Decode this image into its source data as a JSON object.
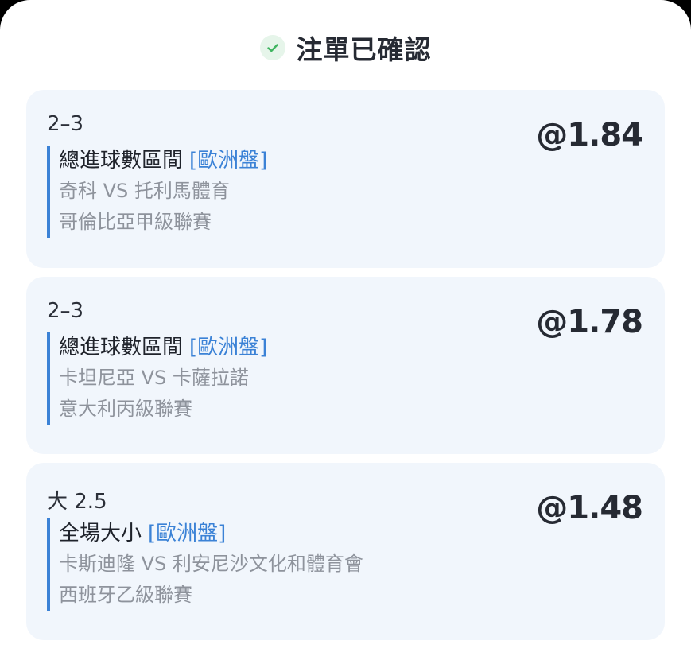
{
  "header": {
    "title": "注單已確認",
    "icon": "check-circle-icon",
    "icon_color": "#3fb560"
  },
  "colors": {
    "card_background": "#f1f6fc",
    "accent": "#3b82d6",
    "muted_text": "#8e939c"
  },
  "bets": [
    {
      "selection": "2–3",
      "odds": "@1.84",
      "market": "總進球數區間",
      "market_tag": "[歐洲盤]",
      "match": "奇科 VS 托利馬體育",
      "league": "哥倫比亞甲級聯賽"
    },
    {
      "selection": "2–3",
      "odds": "@1.78",
      "market": "總進球數區間",
      "market_tag": "[歐洲盤]",
      "match": "卡坦尼亞 VS 卡薩拉諾",
      "league": "意大利丙級聯賽"
    },
    {
      "selection": "大 2.5",
      "odds": "@1.48",
      "market": "全場大小",
      "market_tag": "[歐洲盤]",
      "match": "卡斯迪隆 VS 利安尼沙文化和體育會",
      "league": "西班牙乙級聯賽"
    }
  ]
}
